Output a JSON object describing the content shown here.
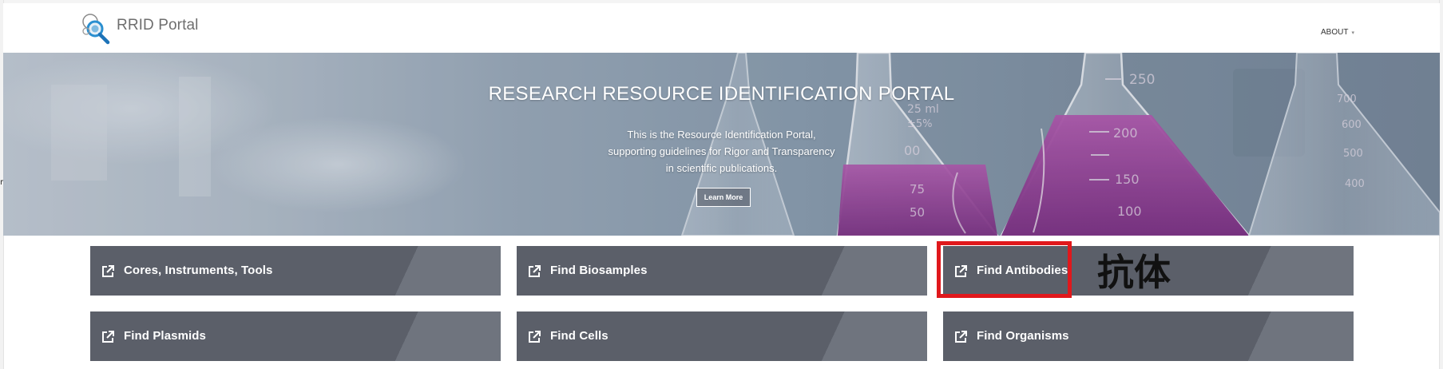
{
  "header": {
    "brand_name": "RRID Portal",
    "about_label": "ABOUT",
    "about_caret": "▾"
  },
  "hero": {
    "title": "RESEARCH RESOURCE IDENTIFICATION PORTAL",
    "description_lines": [
      "This is the Resource Identification Portal,",
      "supporting guidelines for Rigor and Transparency",
      "in scientific publications."
    ],
    "learn_more_label": "Learn More",
    "flask_marks": [
      "250",
      "200",
      "150",
      "100",
      "700",
      "600",
      "500",
      "400",
      "25 ml",
      "±5%",
      "00",
      "75",
      "50"
    ]
  },
  "tiles": [
    {
      "label": "Cores, Instruments, Tools",
      "icon": "external-link-icon"
    },
    {
      "label": "Find Biosamples",
      "icon": "external-link-icon"
    },
    {
      "label": "Find Antibodies",
      "icon": "external-link-icon"
    },
    {
      "label": "Find Plasmids",
      "icon": "external-link-icon"
    },
    {
      "label": "Find Cells",
      "icon": "external-link-icon"
    },
    {
      "label": "Find Organisms",
      "icon": "external-link-icon"
    }
  ],
  "annotation": {
    "text": "抗体",
    "box_color": "#e0181c"
  },
  "edge_glyph": "n",
  "colors": {
    "tile_bg": "#5b5f69",
    "tile_stripe": "#6f747e",
    "liquid": "#9a3f9e",
    "brand_text": "#6e6e6e"
  }
}
